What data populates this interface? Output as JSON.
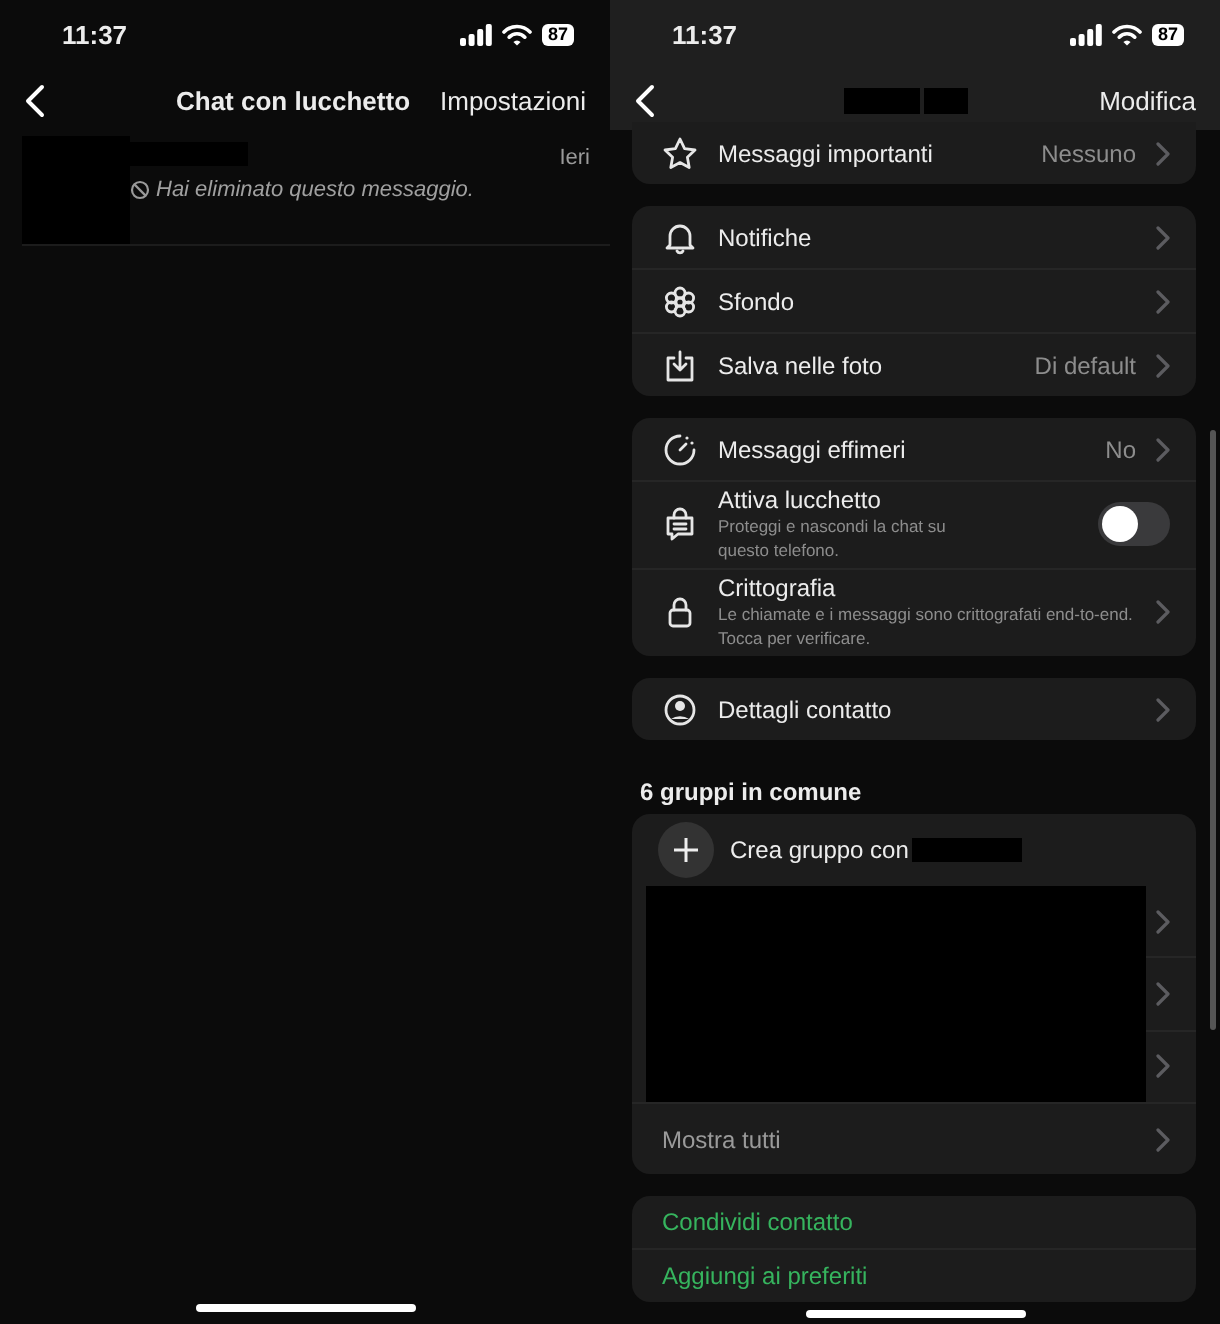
{
  "left": {
    "status": {
      "time": "11:37",
      "battery": "87"
    },
    "nav": {
      "title": "Chat con lucchetto",
      "action": "Impostazioni"
    },
    "chats": [
      {
        "time": "Ieri",
        "preview": "Hai eliminato questo messaggio."
      }
    ]
  },
  "right": {
    "status": {
      "time": "11:37",
      "battery": "87"
    },
    "nav": {
      "action": "Modifica"
    },
    "sections": [
      {
        "rows": [
          {
            "kind": "link",
            "label": "Messaggi importanti",
            "value": "Nessuno"
          }
        ]
      },
      {
        "rows": [
          {
            "kind": "link",
            "label": "Notifiche"
          },
          {
            "kind": "link",
            "label": "Sfondo"
          },
          {
            "kind": "link",
            "label": "Salva nelle foto",
            "value": "Di default"
          }
        ]
      },
      {
        "rows": [
          {
            "kind": "link",
            "label": "Messaggi effimeri",
            "value": "No"
          },
          {
            "kind": "toggle",
            "label": "Attiva lucchetto",
            "detail": "Proteggi e nascondi la chat su questo telefono.",
            "on": false
          },
          {
            "kind": "link",
            "label": "Crittografia",
            "detail": "Le chiamate e i messaggi sono crittografati end-to-end. Tocca per verificare."
          }
        ]
      },
      {
        "rows": [
          {
            "kind": "link",
            "label": "Dettagli contatto"
          }
        ]
      },
      {
        "title": "6 gruppi in comune",
        "rows": [
          {
            "kind": "create",
            "label": "Crea gruppo con"
          },
          {
            "kind": "hidden"
          },
          {
            "kind": "more",
            "label": "Mostra tutti"
          }
        ]
      },
      {
        "rows": [
          {
            "kind": "action",
            "label": "Condividi contatto"
          },
          {
            "kind": "action",
            "label": "Aggiungi ai preferiti"
          }
        ]
      }
    ]
  }
}
